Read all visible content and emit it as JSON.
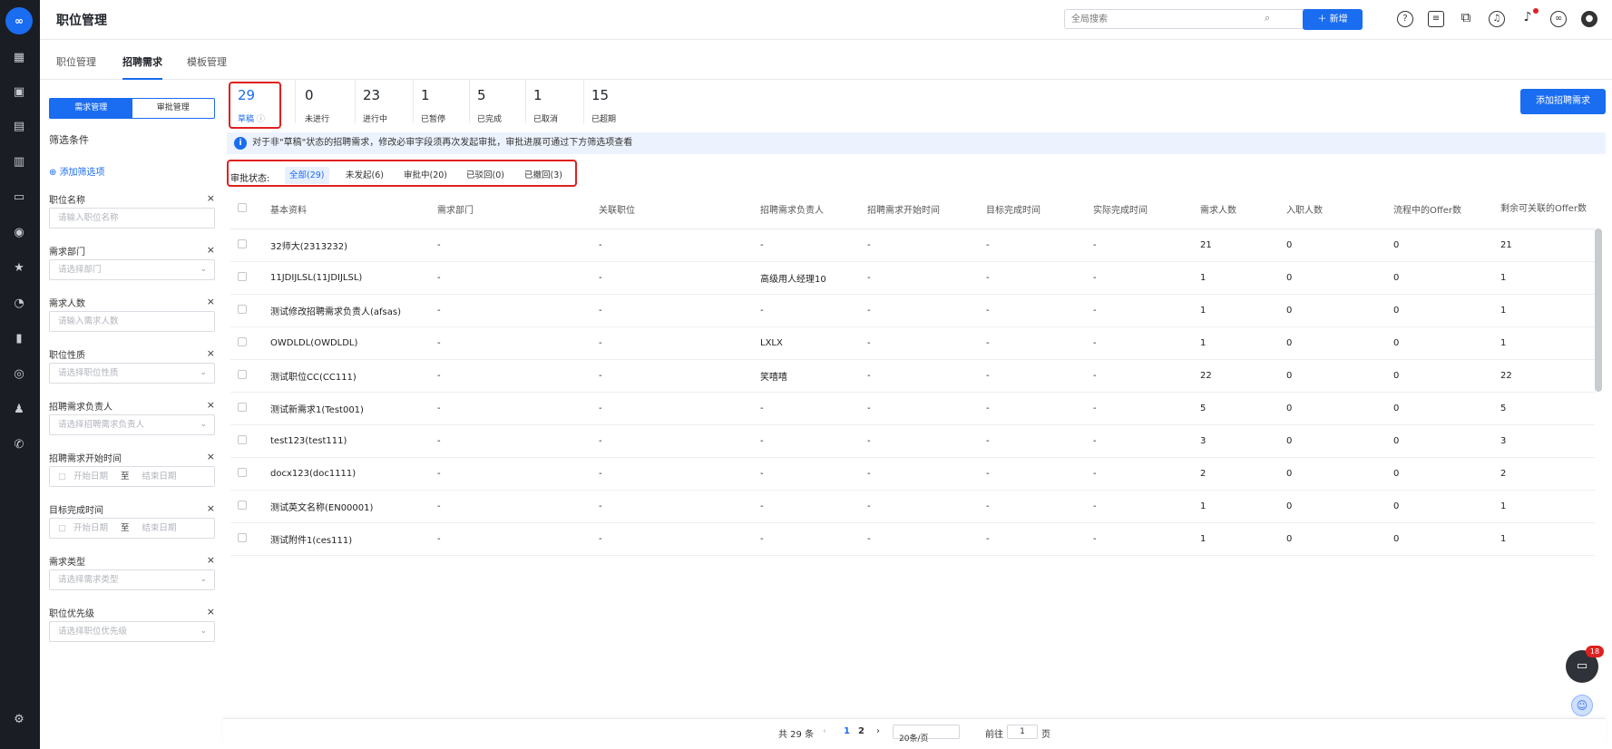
{
  "app": {
    "logo_text": "∞",
    "title": "职位管理",
    "search_placeholder": "全局搜索",
    "new_label": "新增",
    "accent": "#1a6cf0"
  },
  "rail_icons": [
    "dashboard-icon",
    "briefcase-icon",
    "document-icon",
    "calendar-grid-icon",
    "id-card-icon",
    "wechat-icon",
    "star-badge-icon",
    "pie-chart-icon",
    "bar-chart-icon",
    "person-badge-icon",
    "people-icon",
    "phone-icon",
    "settings-icon"
  ],
  "top_icons": [
    "help-icon",
    "notes-icon",
    "puzzle-icon",
    "headset-icon",
    "bell-icon",
    "link-icon",
    "user-icon"
  ],
  "tabs": [
    {
      "label": "职位管理"
    },
    {
      "label": "招聘需求"
    },
    {
      "label": "模板管理"
    }
  ],
  "panel": {
    "seg_active": "需求管理",
    "seg_other": "审批管理",
    "filter_title": "筛选条件",
    "add_filter": "添加筛选项",
    "fields": [
      {
        "label": "职位名称",
        "placeholder": "请输入职位名称",
        "kind": "input"
      },
      {
        "label": "需求部门",
        "placeholder": "请选择部门",
        "kind": "select"
      },
      {
        "label": "需求人数",
        "placeholder": "请输入需求人数",
        "kind": "input"
      },
      {
        "label": "职位性质",
        "placeholder": "请选择职位性质",
        "kind": "select"
      },
      {
        "label": "招聘需求负责人",
        "placeholder": "请选择招聘需求负责人",
        "kind": "select"
      },
      {
        "label": "招聘需求开始时间",
        "start": "开始日期",
        "to": "至",
        "end": "结束日期",
        "kind": "date"
      },
      {
        "label": "目标完成时间",
        "start": "开始日期",
        "to": "至",
        "end": "结束日期",
        "kind": "date"
      },
      {
        "label": "需求类型",
        "placeholder": "请选择需求类型",
        "kind": "select"
      },
      {
        "label": "职位优先级",
        "placeholder": "请选择职位优先级",
        "kind": "select"
      }
    ]
  },
  "stats": [
    {
      "num": "29",
      "label": "草稿"
    },
    {
      "num": "0",
      "label": "未进行"
    },
    {
      "num": "23",
      "label": "进行中"
    },
    {
      "num": "1",
      "label": "已暂停"
    },
    {
      "num": "5",
      "label": "已完成"
    },
    {
      "num": "1",
      "label": "已取消"
    },
    {
      "num": "15",
      "label": "已超期"
    }
  ],
  "add_demand": "添加招聘需求",
  "notice": "对于非\"草稿\"状态的招聘需求，修改必审字段须再次发起审批，审批进展可通过下方筛选项查看",
  "approval": {
    "label": "审批状态:",
    "chips": [
      "全部(29)",
      "未发起(6)",
      "审批中(20)",
      "已驳回(0)",
      "已撤回(3)"
    ]
  },
  "table": {
    "headers": [
      "基本资料",
      "需求部门",
      "关联职位",
      "招聘需求负责人",
      "招聘需求开始时间",
      "目标完成时间",
      "实际完成时间",
      "需求人数",
      "入职人数",
      "流程中的Offer数",
      "剩余可关联的Offer数"
    ],
    "rows": [
      [
        "32师大(2313232)",
        "-",
        "-",
        "-",
        "-",
        "-",
        "-",
        "21",
        "0",
        "0",
        "21"
      ],
      [
        "11JDIJLSL(11JDIJLSL)",
        "-",
        "-",
        "高级用人经理10",
        "-",
        "-",
        "-",
        "1",
        "0",
        "0",
        "1"
      ],
      [
        "测试修改招聘需求负责人(afsas)",
        "-",
        "-",
        "-",
        "-",
        "-",
        "-",
        "1",
        "0",
        "0",
        "1"
      ],
      [
        "OWDLDL(OWDLDL)",
        "-",
        "-",
        "LXLX",
        "-",
        "-",
        "-",
        "1",
        "0",
        "0",
        "1"
      ],
      [
        "测试职位CC(CC111)",
        "-",
        "-",
        "笑嘻嘻",
        "-",
        "-",
        "-",
        "22",
        "0",
        "0",
        "22"
      ],
      [
        "测试新需求1(Test001)",
        "-",
        "-",
        "-",
        "-",
        "-",
        "-",
        "5",
        "0",
        "0",
        "5"
      ],
      [
        "test123(test111)",
        "-",
        "-",
        "-",
        "-",
        "-",
        "-",
        "3",
        "0",
        "0",
        "3"
      ],
      [
        "docx123(doc1111)",
        "-",
        "-",
        "-",
        "-",
        "-",
        "-",
        "2",
        "0",
        "0",
        "2"
      ],
      [
        "测试英文名称(EN00001)",
        "-",
        "-",
        "-",
        "-",
        "-",
        "-",
        "1",
        "0",
        "0",
        "1"
      ],
      [
        "测试附件1(ces111)",
        "-",
        "-",
        "-",
        "-",
        "-",
        "-",
        "1",
        "0",
        "0",
        "1"
      ]
    ]
  },
  "pagination": {
    "total": "共 29 条",
    "pages": [
      "1",
      "2"
    ],
    "page_size": "20条/页",
    "goto_label": "前往",
    "goto_value": "1",
    "page_suffix": "页"
  },
  "chat_badge": "18"
}
